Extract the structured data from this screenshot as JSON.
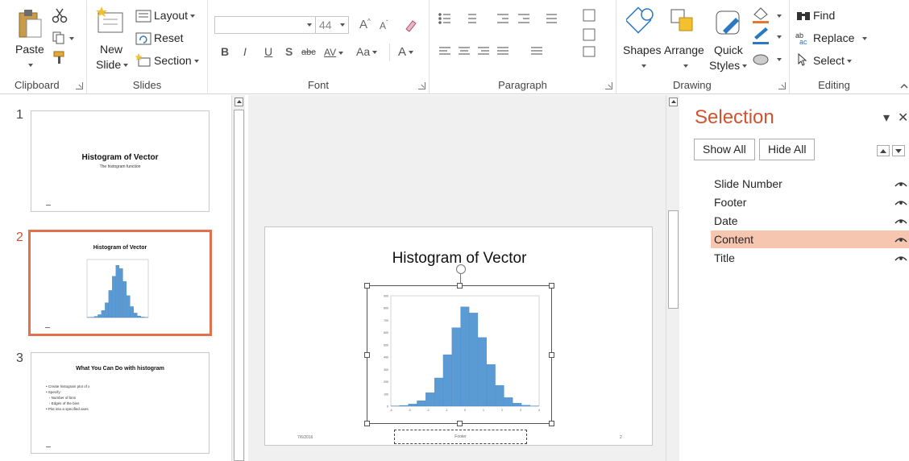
{
  "ribbon": {
    "clipboard": {
      "label": "Clipboard",
      "paste": "Paste"
    },
    "slides": {
      "label": "Slides",
      "new_slide_1": "New",
      "new_slide_2": "Slide",
      "layout": "Layout",
      "reset": "Reset",
      "section": "Section"
    },
    "font": {
      "label": "Font",
      "font_size": "44",
      "bold": "B",
      "italic": "I",
      "underline": "U",
      "shadow": "S",
      "strike": "abc",
      "spacing": "AV",
      "case": "Aa",
      "color": "A",
      "grow": "A",
      "shrink": "A"
    },
    "paragraph": {
      "label": "Paragraph"
    },
    "drawing": {
      "label": "Drawing",
      "shapes": "Shapes",
      "arrange": "Arrange",
      "quick_styles_1": "Quick",
      "quick_styles_2": "Styles"
    },
    "editing": {
      "label": "Editing",
      "find": "Find",
      "replace": "Replace",
      "select": "Select"
    }
  },
  "thumbnails": [
    {
      "number": "1",
      "title": "Histogram of Vector",
      "subtitle": "The histogram function"
    },
    {
      "number": "2",
      "title": "Histogram of Vector"
    },
    {
      "number": "3",
      "title": "What You Can Do with histogram",
      "bullets": [
        "• Create histogram plot of x",
        "• Specify:",
        "   ◦ Number of bins",
        "   ◦ Edges of the bins",
        "• Plot into a specified axes"
      ]
    }
  ],
  "slide": {
    "title": "Histogram of Vector",
    "date": "7/6/2016",
    "footer": "Footer",
    "number": "2"
  },
  "selection_pane": {
    "title": "Selection",
    "show_all": "Show All",
    "hide_all": "Hide All",
    "items": [
      "Slide Number",
      "Footer",
      "Date",
      "Content",
      "Title"
    ],
    "selected_item": "Content"
  },
  "colors": {
    "accent": "#d35230",
    "selected_row": "#f6c6b1",
    "bar": "#5b9bd5",
    "thumb_border": "#e2704d"
  },
  "chart_data": {
    "type": "bar",
    "x": [
      -4,
      -3.5,
      -3,
      -2.5,
      -2,
      -1.5,
      -1,
      -0.5,
      0,
      0.5,
      1,
      1.5,
      2,
      2.5,
      3,
      3.5,
      4
    ],
    "values": [
      2,
      6,
      18,
      45,
      110,
      230,
      420,
      640,
      810,
      760,
      560,
      340,
      170,
      70,
      25,
      8,
      2
    ],
    "ylim": [
      0,
      900
    ],
    "yticks": [
      "0",
      "100",
      "200",
      "300",
      "400",
      "500",
      "600",
      "700",
      "800",
      "900"
    ],
    "xticks": [
      "-4",
      "-3",
      "-2",
      "-1",
      "0",
      "1",
      "2",
      "3",
      "4"
    ]
  }
}
